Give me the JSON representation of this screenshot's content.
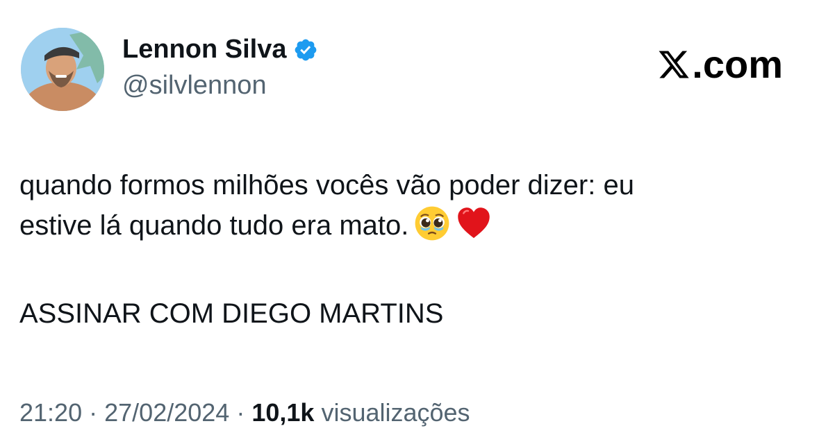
{
  "author": {
    "display_name": "Lennon Silva",
    "handle": "@silvlennon",
    "verified": true,
    "verified_color": "#1d9bf0"
  },
  "brand": {
    "label": ".com"
  },
  "tweet": {
    "text_line1": "quando formos milhões vocês vão poder dizer: eu",
    "text_line2": "estive lá quando tudo era mato.",
    "emojis": [
      "pleading-face",
      "red-heart"
    ],
    "signature": "ASSINAR COM DIEGO MARTINS"
  },
  "meta": {
    "time": "21:20",
    "separator": "·",
    "date": "27/02/2024",
    "views_count": "10,1k",
    "views_label": "visualizações"
  }
}
